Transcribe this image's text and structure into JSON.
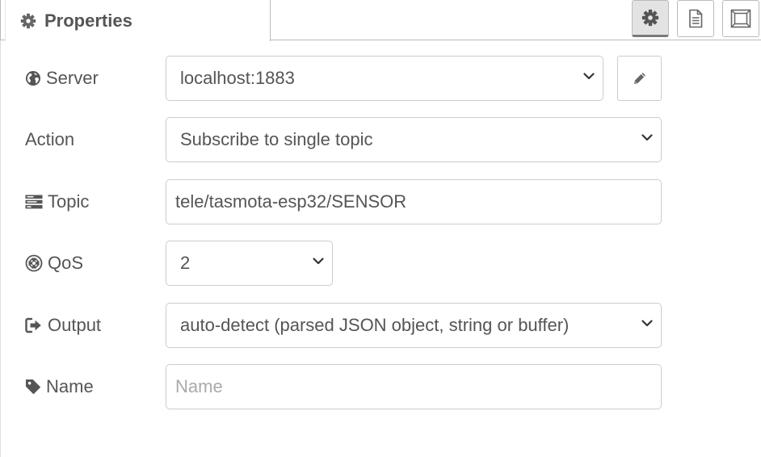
{
  "tab": {
    "label": "Properties",
    "icon": "gear-icon"
  },
  "tab_buttons": [
    {
      "name": "properties-tab-button",
      "icon": "gear-icon",
      "selected": true
    },
    {
      "name": "description-tab-button",
      "icon": "document-icon",
      "selected": false
    },
    {
      "name": "appearance-tab-button",
      "icon": "frame-icon",
      "selected": false
    }
  ],
  "form": {
    "server": {
      "label": "Server",
      "icon": "globe-icon",
      "value": "localhost:1883",
      "edit_icon": "pencil-icon"
    },
    "action": {
      "label": "Action",
      "value": "Subscribe to single topic"
    },
    "topic": {
      "label": "Topic",
      "icon": "tasks-icon",
      "value": "tele/tasmota-esp32/SENSOR"
    },
    "qos": {
      "label": "QoS",
      "icon": "life-ring-icon",
      "value": "2"
    },
    "output": {
      "label": "Output",
      "icon": "sign-out-icon",
      "value": "auto-detect (parsed JSON object, string or buffer)"
    },
    "name": {
      "label": "Name",
      "icon": "tag-icon",
      "value": "",
      "placeholder": "Name"
    }
  },
  "colors": {
    "text": "#555555",
    "border": "#cccccc",
    "selected_button": "#e3e3e3",
    "placeholder": "#aaaaaa"
  }
}
